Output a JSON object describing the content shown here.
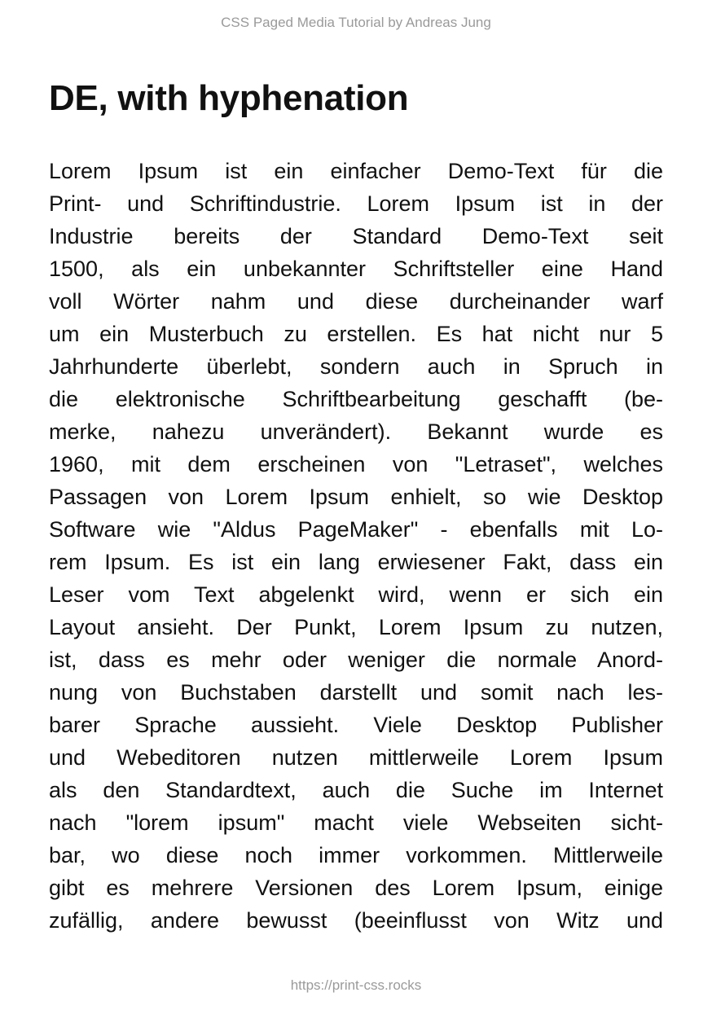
{
  "header": {
    "text": "CSS Paged Media Tutorial by Andreas Jung"
  },
  "title": "DE, with hyphenation",
  "paragraph_lines": [
    "Lorem Ipsum ist ein einfacher Demo-Text für die",
    "Print- und Schriftindustrie. Lorem Ipsum ist in der",
    "Industrie bereits der Standard Demo-Text seit",
    "1500, als ein unbekannter Schriftsteller eine Hand",
    "voll Wörter nahm und diese durcheinander warf",
    "um ein Musterbuch zu erstellen. Es hat nicht nur 5",
    "Jahrhunderte überlebt, sondern auch in Spruch in",
    "die elektronische Schriftbearbeitung geschafft (be-",
    "merke, nahezu unverändert). Bekannt wurde es",
    "1960, mit dem erscheinen von \"Letraset\", welches",
    "Passagen von Lorem Ipsum enhielt, so wie Desktop",
    "Software wie \"Aldus PageMaker\" - ebenfalls mit Lo-",
    "rem Ipsum. Es ist ein lang erwiesener Fakt, dass ein",
    "Leser vom Text abgelenkt wird, wenn er sich ein",
    "Layout ansieht. Der Punkt, Lorem Ipsum zu nutzen,",
    "ist, dass es mehr oder weniger die normale Anord-",
    "nung von Buchstaben darstellt und somit nach les-",
    "barer Sprache aussieht. Viele Desktop Publisher",
    "und Webeditoren nutzen mittlerweile Lorem Ipsum",
    "als den Standardtext, auch die Suche im Internet",
    "nach \"lorem ipsum\" macht viele Webseiten sicht-",
    "bar, wo diese noch immer vorkommen. Mittlerweile",
    "gibt es mehrere Versionen des Lorem Ipsum, einige",
    "zufällig, andere bewusst (beeinflusst von Witz und"
  ],
  "footer": {
    "text": "https://print-css.rocks"
  }
}
